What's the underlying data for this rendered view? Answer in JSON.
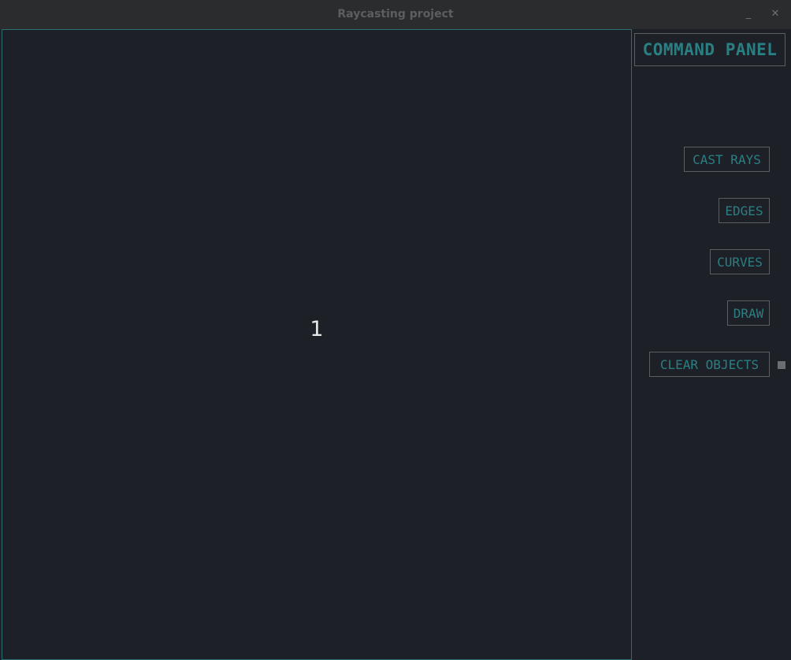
{
  "window": {
    "title": "Raycasting project",
    "minimize_label": "_",
    "close_label": "✕"
  },
  "canvas": {
    "label": "1"
  },
  "panel": {
    "title": "COMMAND PANEL",
    "buttons": [
      {
        "label": "CAST RAYS"
      },
      {
        "label": "EDGES"
      },
      {
        "label": "CURVES"
      },
      {
        "label": "DRAW"
      },
      {
        "label": "CLEAR OBJECTS"
      }
    ]
  },
  "colors": {
    "accent": "#2a7f82",
    "background": "#1e2028",
    "border": "#5a5e63",
    "canvas_border": "#2b6d70"
  }
}
